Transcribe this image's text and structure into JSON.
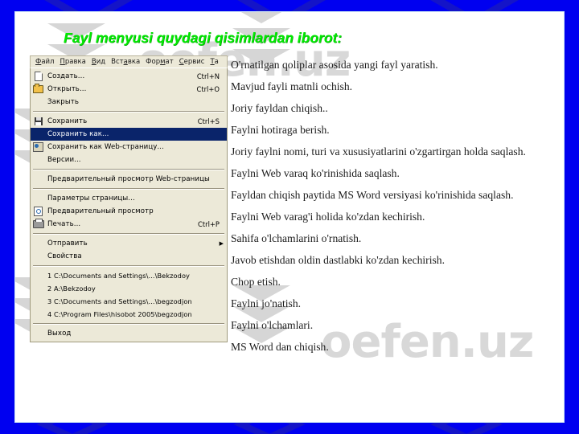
{
  "slide": {
    "title": "Fayl menyusi quydagi qisimlardan iborot:",
    "title_color": "#00ea00",
    "frame_color": "#0000f0",
    "background": "#ffffff",
    "watermark": "oefen.uz"
  },
  "word_window": {
    "menubar": [
      {
        "label": "Файл",
        "mnemonic": "Ф"
      },
      {
        "label": "Правка",
        "mnemonic": "П"
      },
      {
        "label": "Вид",
        "mnemonic": "В"
      },
      {
        "label": "Вставка",
        "mnemonic": "а"
      },
      {
        "label": "Формат",
        "mnemonic": "м"
      },
      {
        "label": "Сервис",
        "mnemonic": "С"
      },
      {
        "label": "Та",
        "mnemonic": "Т"
      }
    ],
    "selected_menu": "Файл",
    "highlight_color": "#0a246a",
    "panel_color": "#ece9d8",
    "items": [
      {
        "label": "Создать...",
        "accel": "Ctrl+N",
        "icon": "new-document-icon",
        "selected": false,
        "submenu": false
      },
      {
        "label": "Открыть...",
        "accel": "Ctrl+O",
        "icon": "open-folder-icon",
        "selected": false,
        "submenu": false
      },
      {
        "label": "Закрыть",
        "accel": "",
        "icon": "",
        "selected": false,
        "submenu": false
      },
      {
        "separator": true
      },
      {
        "label": "Сохранить",
        "accel": "Ctrl+S",
        "icon": "save-disk-icon",
        "selected": false,
        "submenu": false
      },
      {
        "label": "Сохранить как...",
        "accel": "",
        "icon": "",
        "selected": true,
        "submenu": false
      },
      {
        "label": "Сохранить как Web-страницу...",
        "accel": "",
        "icon": "save-web-icon",
        "selected": false,
        "submenu": false
      },
      {
        "label": "Версии...",
        "accel": "",
        "icon": "",
        "selected": false,
        "submenu": false
      },
      {
        "separator": true
      },
      {
        "label": "Предварительный просмотр Web-страницы",
        "accel": "",
        "icon": "",
        "selected": false,
        "submenu": false
      },
      {
        "separator": true
      },
      {
        "label": "Параметры страницы...",
        "accel": "",
        "icon": "",
        "selected": false,
        "submenu": false
      },
      {
        "label": "Предварительный просмотр",
        "accel": "",
        "icon": "print-preview-icon",
        "selected": false,
        "submenu": false
      },
      {
        "label": "Печать...",
        "accel": "Ctrl+P",
        "icon": "printer-icon",
        "selected": false,
        "submenu": false
      },
      {
        "separator": true
      },
      {
        "label": "Отправить",
        "accel": "",
        "icon": "",
        "selected": false,
        "submenu": true
      },
      {
        "label": "Свойства",
        "accel": "",
        "icon": "",
        "selected": false,
        "submenu": false
      },
      {
        "separator": true
      },
      {
        "label": "1 C:\\Documents and Settings\\...\\Bekzodoy",
        "accel": "",
        "icon": "",
        "selected": false,
        "submenu": false,
        "recent": true
      },
      {
        "label": "2 A:\\Bekzodoy",
        "accel": "",
        "icon": "",
        "selected": false,
        "submenu": false,
        "recent": true
      },
      {
        "label": "3 C:\\Documents and Settings\\...\\begzodjon",
        "accel": "",
        "icon": "",
        "selected": false,
        "submenu": false,
        "recent": true
      },
      {
        "label": "4 C:\\Program Files\\hisobot 2005\\begzodjon",
        "accel": "",
        "icon": "",
        "selected": false,
        "submenu": false,
        "recent": true
      },
      {
        "separator": true
      },
      {
        "label": "Выход",
        "accel": "",
        "icon": "",
        "selected": false,
        "submenu": false
      }
    ]
  },
  "descriptions": [
    "O'rnatilgan  qoliplar  asosida yangi  fayl  yaratish.",
    "Mavjud fayli  matnli  ochish.",
    "Joriy  fayldan  chiqish..",
    "Faylni  hotiraga  berish.",
    "Joriy faylni nomi, turi va xususiyatlarini o'zgartirgan holda saqlash.",
    "Faylni  Web  varaq  ko'rinishida  saqlash.",
    "Fayldan  chiqish  paytida  MS  Word  versiyasi ko'rinishida  saqlash.",
    "Faylni  Web  varag'i  holida  ko'zdan  kechirish.",
    "Sahifa  o'lchamlarini  o'rnatish.",
    "Javob  etishdan  oldin  dastlabki  ko'zdan  kechirish.",
    "Chop  etish.",
    "Faylni  jo'natish.",
    "Faylni  o'lchamlari.",
    "MS Word dan  chiqish."
  ]
}
